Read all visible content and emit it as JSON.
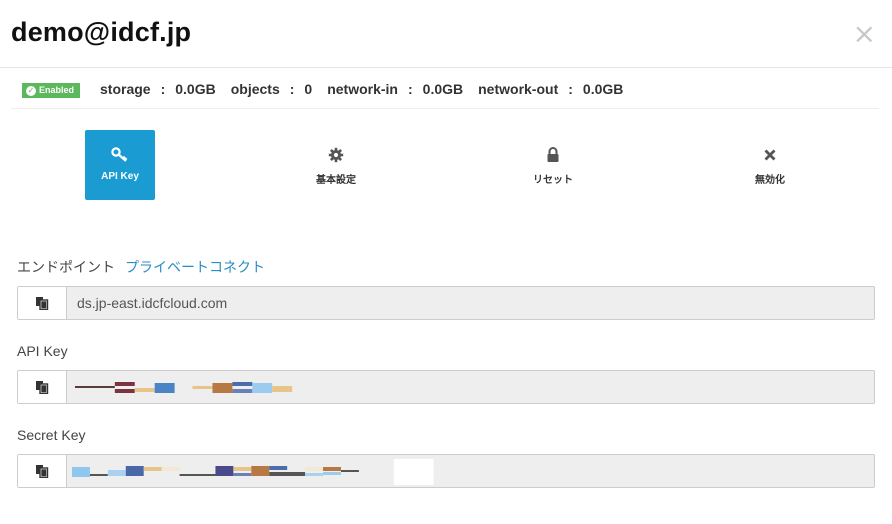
{
  "header": {
    "title": "demo@idcf.jp",
    "close_symbol": "×"
  },
  "status": {
    "badge": "Enabled",
    "color": "#5cb85c"
  },
  "stats": [
    {
      "label": "storage",
      "value": "0.0GB"
    },
    {
      "label": "objects",
      "value": "0"
    },
    {
      "label": "network-in",
      "value": "0.0GB"
    },
    {
      "label": "network-out",
      "value": "0.0GB"
    }
  ],
  "actions": [
    {
      "label": "API Key",
      "icon": "key-icon",
      "active": true
    },
    {
      "label": "基本設定",
      "icon": "gear-icon",
      "active": false
    },
    {
      "label": "リセット",
      "icon": "lock-icon",
      "active": false
    },
    {
      "label": "無効化",
      "icon": "x-icon",
      "active": false
    }
  ],
  "endpoint": {
    "label": "エンドポイント",
    "link": "プライベートコネクト",
    "value": "ds.jp-east.idcfcloud.com"
  },
  "api_key": {
    "label": "API Key",
    "value_masked": true
  },
  "secret_key": {
    "label": "Secret Key",
    "value_masked": true
  },
  "colors": {
    "accent": "#1a9cd3",
    "link": "#2a8cc6"
  }
}
